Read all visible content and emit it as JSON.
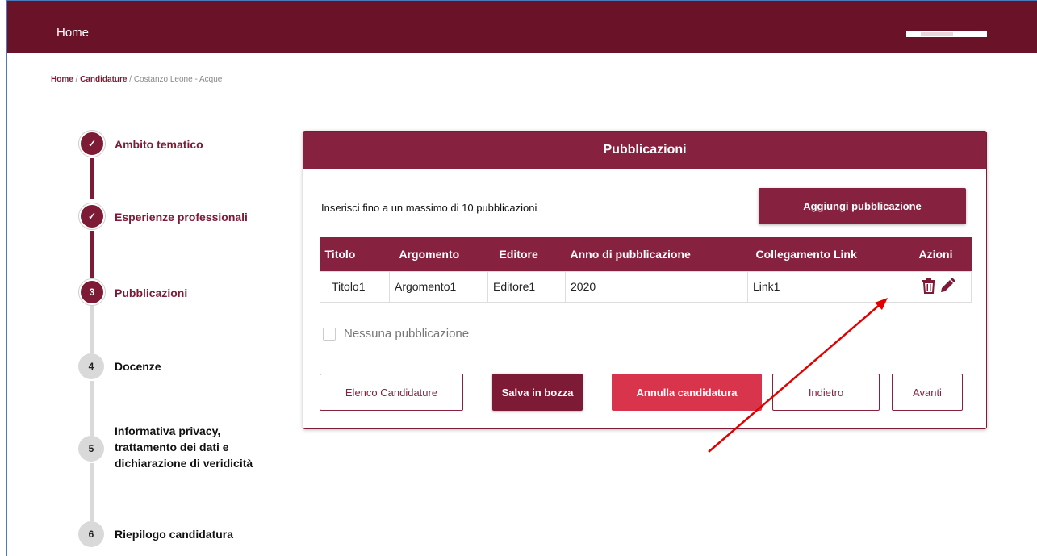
{
  "topbar": {
    "home": "Home"
  },
  "breadcrumb": {
    "home": "Home",
    "sep1": " / ",
    "candidature": "Candidature",
    "sep2": " / ",
    "current": "Costanzo Leone - Acque"
  },
  "steps": [
    {
      "marker": "✓",
      "label": "Ambito tematico",
      "state": "done"
    },
    {
      "marker": "✓",
      "label": "Esperienze professionali",
      "state": "done"
    },
    {
      "marker": "3",
      "label": "Pubblicazioni",
      "state": "active"
    },
    {
      "marker": "4",
      "label": "Docenze",
      "state": "todo"
    },
    {
      "marker": "5",
      "label_lines": [
        "Informativa privacy,",
        "trattamento dei dati e",
        "dichiarazione di veridicità"
      ],
      "state": "todo"
    },
    {
      "marker": "6",
      "label": "Riepilogo candidatura",
      "state": "todo"
    }
  ],
  "card": {
    "title": "Pubblicazioni",
    "intro": "Inserisci fino a un massimo di 10 pubblicazioni",
    "add_button": "Aggiungi pubblicazione",
    "table": {
      "headers": [
        "Titolo",
        "Argomento",
        "Editore",
        "Anno di pubblicazione",
        "Collegamento Link",
        "Azioni"
      ],
      "rows": [
        {
          "titolo": "Titolo1",
          "argomento": "Argomento1",
          "editore": "Editore1",
          "anno": "2020",
          "link": "Link1"
        }
      ]
    },
    "no_pub_label": "Nessuna pubblicazione",
    "buttons": {
      "elenco": "Elenco Candidature",
      "salva": "Salva in bozza",
      "annulla": "Annulla candidatura",
      "indietro": "Indietro",
      "avanti": "Avanti"
    }
  },
  "colors": {
    "brand": "#7d1a35",
    "header": "#86213f",
    "danger": "#d8354d",
    "annotation_arrow": "#e00000"
  }
}
